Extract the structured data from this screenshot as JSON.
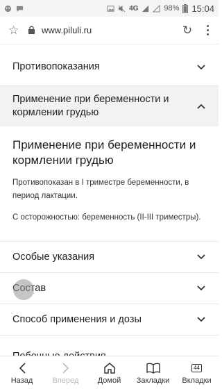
{
  "statusbar": {
    "network": "4G",
    "battery": "98%",
    "time": "15:04"
  },
  "browser": {
    "url": "www.piluli.ru"
  },
  "sections": {
    "contraindications": "Противопоказания",
    "pregnancy_header": "Применение при беременности и кормлении грудью",
    "pregnancy_title": "Применение при беременности и кормлении грудью",
    "pregnancy_p1": "Противопоказан в I триместре беременности, в период лактации.",
    "pregnancy_p2": "С осторожностью: беременность (II-III триместры).",
    "special": "Особые указания",
    "composition": "Состав",
    "dosage": "Способ применения и дозы",
    "side_effects": "Побочные действия"
  },
  "nav": {
    "back": "Назад",
    "forward": "Вперед",
    "home": "Домой",
    "bookmarks": "Закладки",
    "tabs": "Вкладки",
    "tab_count": "44"
  }
}
